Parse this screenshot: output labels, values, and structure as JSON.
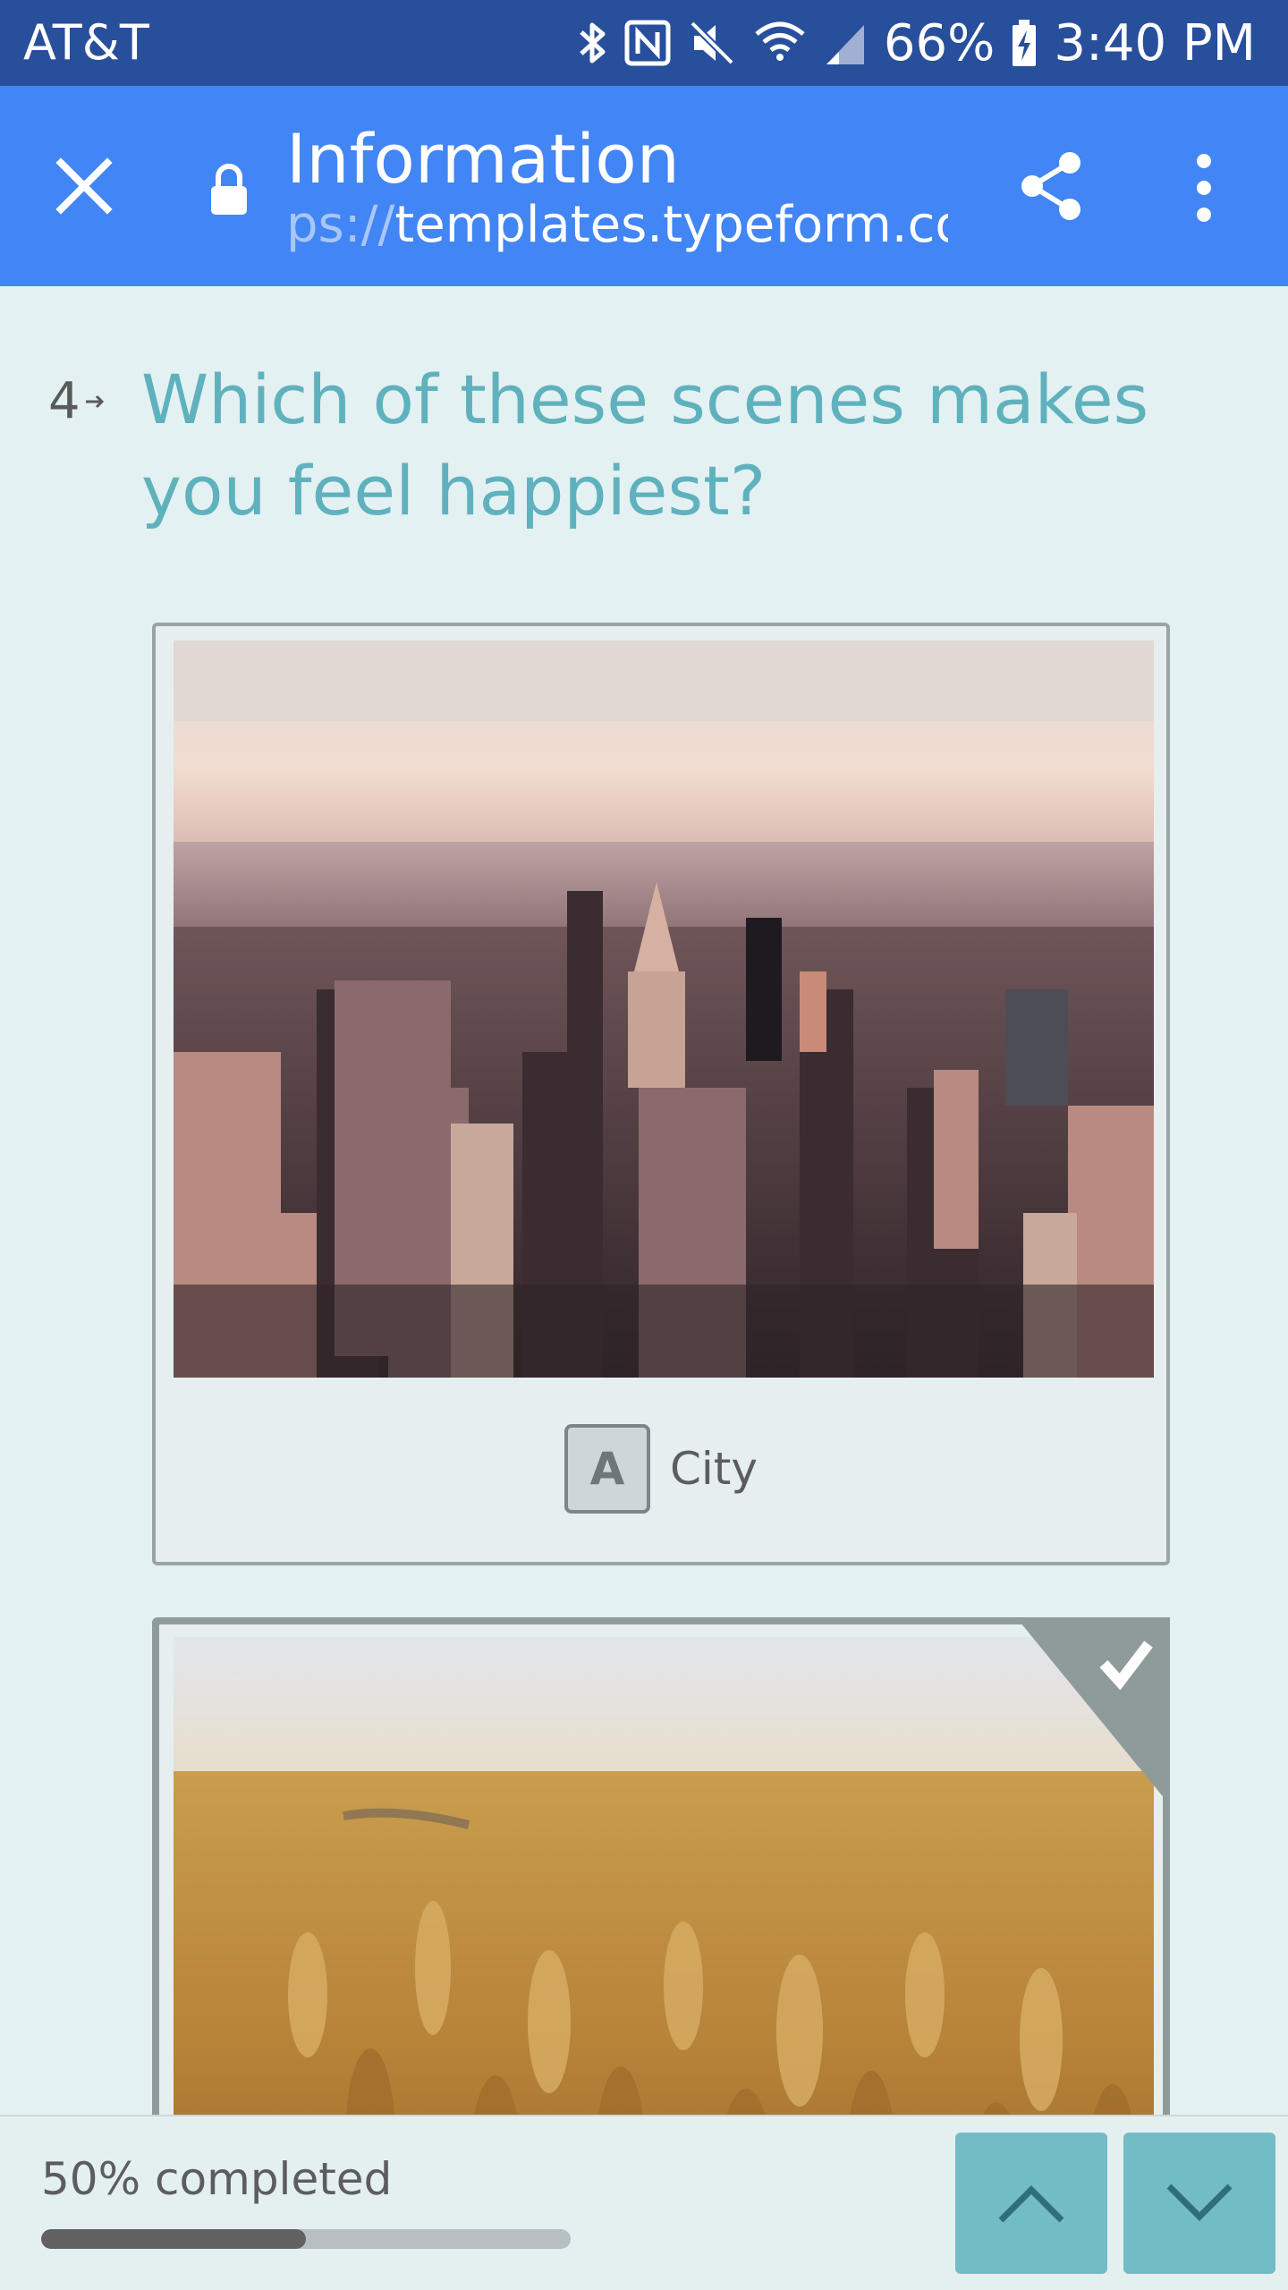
{
  "status_bar": {
    "carrier": "AT&T",
    "battery_percent": "66%",
    "time": "3:40 PM",
    "icons": [
      "bluetooth-icon",
      "nfc-icon",
      "mute-icon",
      "wifi-icon",
      "signal-icon",
      "battery-charging-icon"
    ]
  },
  "app_bar": {
    "title": "Information",
    "url_scheme": "ps://",
    "url_host": "templates.typeform.com",
    "icons": [
      "close-icon",
      "lock-icon",
      "share-icon",
      "more-vert-icon"
    ]
  },
  "question": {
    "number": "4",
    "text": "Which of these scenes makes you feel happiest?"
  },
  "choices": [
    {
      "key": "A",
      "label": "City",
      "image": "city-skyline-photo",
      "selected": false
    },
    {
      "key": "",
      "label": "",
      "image": "wheat-field-photo",
      "selected": true
    }
  ],
  "footer": {
    "progress_text": "50% completed",
    "progress_fraction": 0.5,
    "up_icon": "chevron-up-icon",
    "down_icon": "chevron-down-icon"
  },
  "colors": {
    "status_bar": "#284f9c",
    "app_bar": "#4285f4",
    "background": "#e4f1f2",
    "question_text": "#5fb2bd",
    "nav_button": "#72bcc6",
    "check_corner": "#8f9a9b"
  }
}
